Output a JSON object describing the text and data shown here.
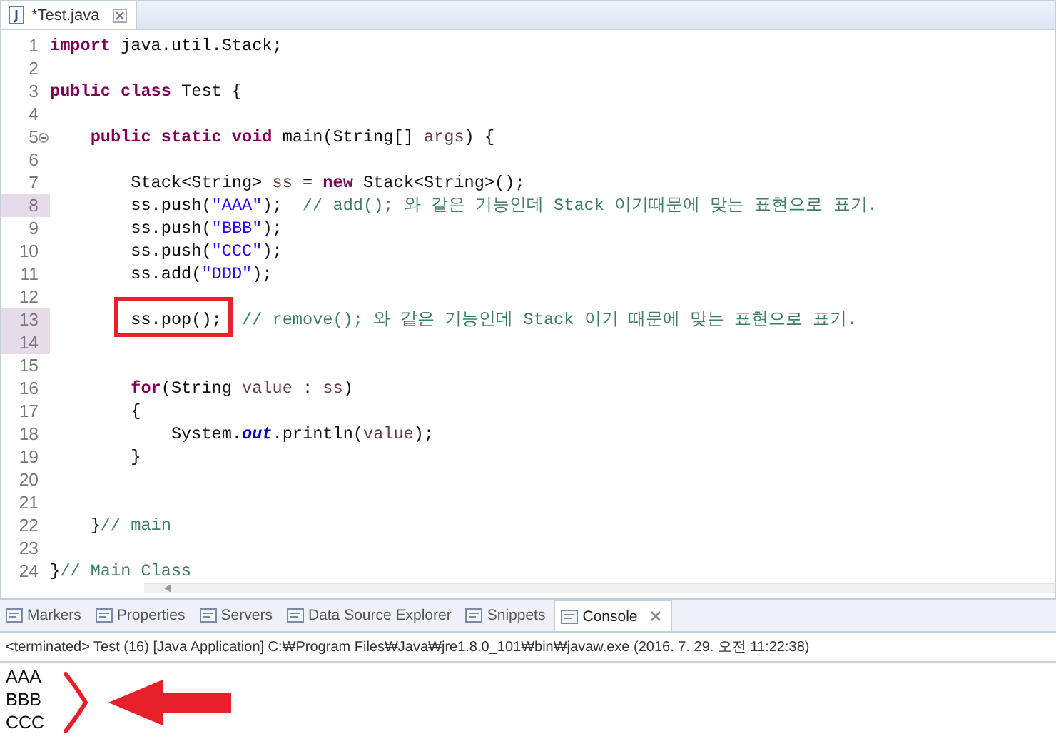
{
  "editor_tabs": [
    {
      "label": "*Test.java",
      "selected": true
    }
  ],
  "editor": {
    "lines": [
      {
        "number": "1",
        "changed": false,
        "fold": false,
        "tokens": [
          {
            "kind": "keyword",
            "text": "import"
          },
          {
            "kind": "plain",
            "text": " java.util.Stack;"
          }
        ]
      },
      {
        "number": "2",
        "changed": false,
        "fold": false
      },
      {
        "number": "3",
        "changed": false,
        "fold": false,
        "tokens": [
          {
            "kind": "keyword",
            "text": "public class"
          },
          {
            "kind": "plain",
            "text": " Test {"
          }
        ]
      },
      {
        "number": "4",
        "changed": false,
        "fold": false
      },
      {
        "number": "5",
        "changed": false,
        "fold": true,
        "tokens": [
          {
            "kind": "keyword",
            "text": "    public static void"
          },
          {
            "kind": "plain",
            "text": " main(String[] "
          },
          {
            "kind": "variable",
            "text": "args"
          },
          {
            "kind": "plain",
            "text": ") {"
          }
        ]
      },
      {
        "number": "6",
        "changed": false,
        "fold": false
      },
      {
        "number": "7",
        "changed": false,
        "fold": false,
        "tokens": [
          {
            "kind": "plain",
            "text": "        Stack<String> "
          },
          {
            "kind": "variable",
            "text": "ss"
          },
          {
            "kind": "plain",
            "text": " = "
          },
          {
            "kind": "keyword",
            "text": "new"
          },
          {
            "kind": "plain",
            "text": " Stack<String>();"
          }
        ]
      },
      {
        "number": "8",
        "changed": true,
        "fold": false,
        "tokens": [
          {
            "kind": "plain",
            "text": "        ss.push("
          },
          {
            "kind": "string",
            "text": "\"AAA\""
          },
          {
            "kind": "plain",
            "text": ");  "
          },
          {
            "kind": "comment",
            "text": "// add(); 와 같은 기능인데 Stack 이기때문에 맞는 표현으로 표기."
          }
        ]
      },
      {
        "number": "9",
        "changed": false,
        "fold": false,
        "tokens": [
          {
            "kind": "plain",
            "text": "        ss.push("
          },
          {
            "kind": "string",
            "text": "\"BBB\""
          },
          {
            "kind": "plain",
            "text": ");"
          }
        ]
      },
      {
        "number": "10",
        "changed": false,
        "fold": false,
        "tokens": [
          {
            "kind": "plain",
            "text": "        ss.push("
          },
          {
            "kind": "string",
            "text": "\"CCC\""
          },
          {
            "kind": "plain",
            "text": ");"
          }
        ]
      },
      {
        "number": "11",
        "changed": false,
        "fold": false,
        "tokens": [
          {
            "kind": "plain",
            "text": "        ss.add("
          },
          {
            "kind": "string",
            "text": "\"DDD\""
          },
          {
            "kind": "plain",
            "text": ");"
          }
        ]
      },
      {
        "number": "12",
        "changed": false,
        "fold": false
      },
      {
        "number": "13",
        "changed": true,
        "fold": false,
        "tokens": [
          {
            "kind": "plain",
            "text": "        ss.pop();",
            "boxed": true
          },
          {
            "kind": "comment",
            "text": "  // remove(); 와 같은 기능인데 Stack 이기 때문에 맞는 표현으로 표기."
          }
        ]
      },
      {
        "number": "14",
        "changed": true,
        "fold": false
      },
      {
        "number": "15",
        "changed": false,
        "fold": false
      },
      {
        "number": "16",
        "changed": false,
        "fold": false,
        "tokens": [
          {
            "kind": "keyword",
            "text": "        for"
          },
          {
            "kind": "plain",
            "text": "(String "
          },
          {
            "kind": "variable",
            "text": "value"
          },
          {
            "kind": "plain",
            "text": " : "
          },
          {
            "kind": "variable",
            "text": "ss"
          },
          {
            "kind": "plain",
            "text": ")"
          }
        ]
      },
      {
        "number": "17",
        "changed": false,
        "fold": false,
        "tokens": [
          {
            "kind": "plain",
            "text": "        {"
          }
        ]
      },
      {
        "number": "18",
        "changed": false,
        "fold": false,
        "tokens": [
          {
            "kind": "plain",
            "text": "            System."
          },
          {
            "kind": "field",
            "text": "out"
          },
          {
            "kind": "plain",
            "text": ".println("
          },
          {
            "kind": "variable",
            "text": "value"
          },
          {
            "kind": "plain",
            "text": ");"
          }
        ]
      },
      {
        "number": "19",
        "changed": false,
        "fold": false,
        "tokens": [
          {
            "kind": "plain",
            "text": "        }"
          }
        ]
      },
      {
        "number": "20",
        "changed": false,
        "fold": false
      },
      {
        "number": "21",
        "changed": false,
        "fold": false
      },
      {
        "number": "22",
        "changed": false,
        "fold": false,
        "tokens": [
          {
            "kind": "plain",
            "text": "    }"
          },
          {
            "kind": "comment",
            "text": "// main"
          }
        ]
      },
      {
        "number": "23",
        "changed": false,
        "fold": false
      },
      {
        "number": "24",
        "changed": false,
        "fold": false,
        "tokens": [
          {
            "kind": "plain",
            "text": "}"
          },
          {
            "kind": "comment",
            "text": "// Main Class"
          }
        ]
      }
    ]
  },
  "view_tabs": [
    {
      "label": "Markers",
      "selected": false
    },
    {
      "label": "Properties",
      "selected": false
    },
    {
      "label": "Servers",
      "selected": false
    },
    {
      "label": "Data Source Explorer",
      "selected": false
    },
    {
      "label": "Snippets",
      "selected": false
    },
    {
      "label": "Console",
      "selected": true
    }
  ],
  "console": {
    "header": "<terminated> Test (16) [Java Application] C:₩Program Files₩Java₩jre1.8.0_101₩bin₩javaw.exe (2016. 7. 29. 오전 11:22:38)",
    "output": [
      "AAA",
      "BBB",
      "CCC"
    ]
  }
}
